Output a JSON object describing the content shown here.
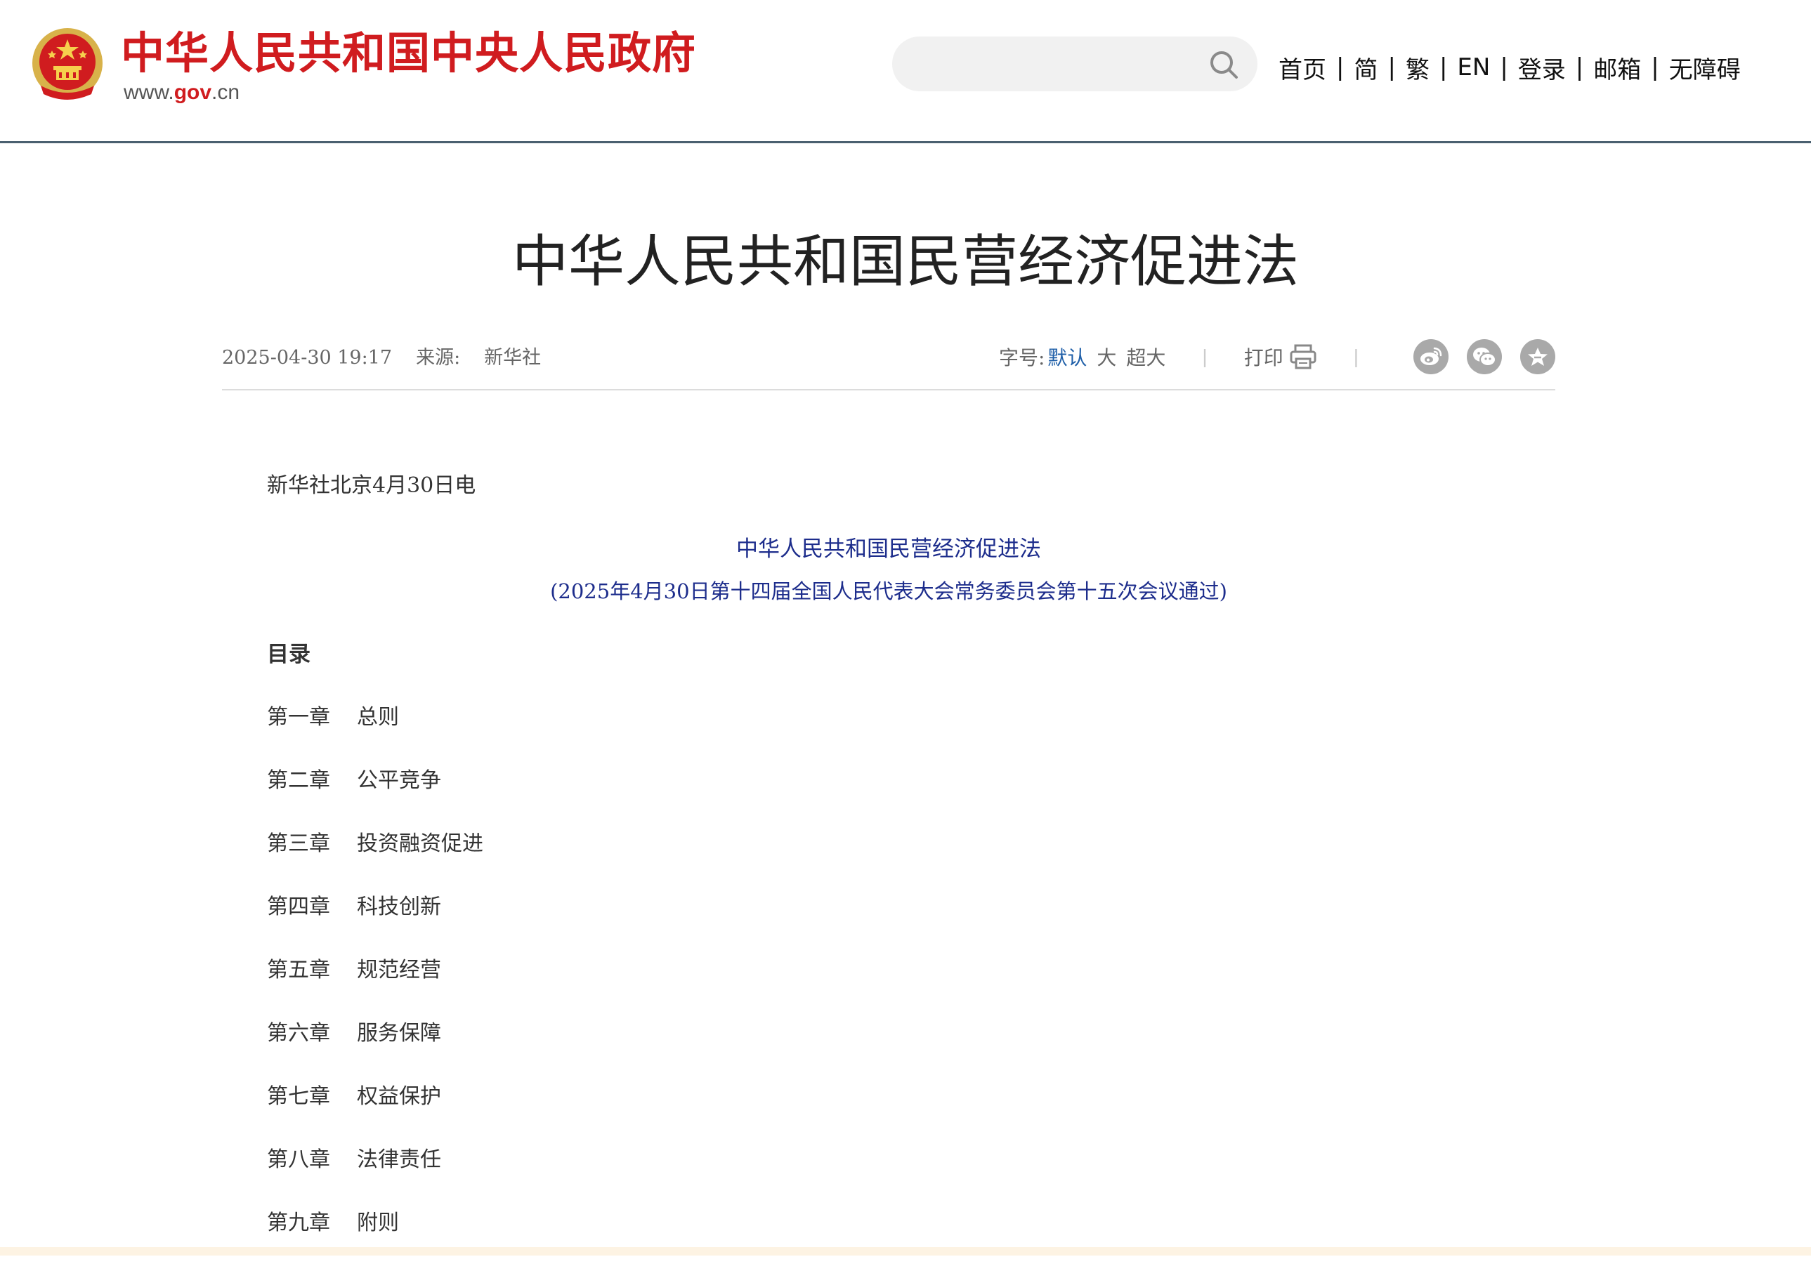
{
  "header": {
    "site_title": "中华人民共和国中央人民政府",
    "site_url_prefix": "www.",
    "site_url_domain": "gov",
    "site_url_suffix": ".cn",
    "search": {
      "placeholder": "",
      "value": ""
    },
    "nav": [
      "首页",
      "简",
      "繁",
      "EN",
      "登录",
      "邮箱",
      "无障碍"
    ],
    "nav_separator": "|"
  },
  "article": {
    "title": "中华人民共和国民营经济促进法",
    "meta": {
      "datetime": "2025-04-30 19:17",
      "source_label": "来源:",
      "source": "新华社",
      "font_size_label": "字号:",
      "font_sizes": [
        "默认",
        "大",
        "超大"
      ],
      "font_size_selected": "默认",
      "print_label": "打印",
      "divider": "|",
      "share_icons": [
        "weibo-icon",
        "wechat-icon",
        "favorite-icon"
      ]
    },
    "dateline": "新华社北京4月30日电",
    "law_heading": "中华人民共和国民营经济促进法",
    "law_subheading": "(2025年4月30日第十四届全国人民代表大会常务委员会第十五次会议通过)",
    "toc_title": "目录",
    "toc": [
      {
        "num": "第一章",
        "name": "总则"
      },
      {
        "num": "第二章",
        "name": "公平竞争"
      },
      {
        "num": "第三章",
        "name": "投资融资促进"
      },
      {
        "num": "第四章",
        "name": "科技创新"
      },
      {
        "num": "第五章",
        "name": "规范经营"
      },
      {
        "num": "第六章",
        "name": "服务保障"
      },
      {
        "num": "第七章",
        "name": "权益保护"
      },
      {
        "num": "第八章",
        "name": "法律责任"
      },
      {
        "num": "第九章",
        "name": "附则"
      }
    ]
  },
  "colors": {
    "brand_red": "#d01c1f",
    "law_blue": "#1d2d8c",
    "active_link_blue": "#1f5fa8",
    "header_rule": "#4a6070"
  }
}
